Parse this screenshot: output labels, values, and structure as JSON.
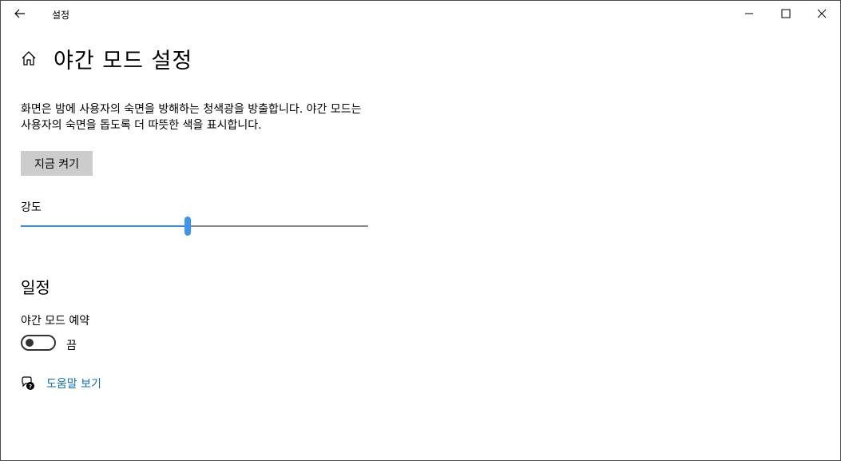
{
  "titlebar": {
    "app_title": "설정",
    "icons": [
      "back-arrow-icon",
      "minimize-icon",
      "maximize-icon",
      "close-icon"
    ]
  },
  "header": {
    "title": "야간 모드 설정",
    "icon": "home-icon"
  },
  "description": "화면은 밤에 사용자의 숙면을 방해하는 청색광을 방출합니다. 야간 모드는 사용자의 숙면을 돕도록 더 따뜻한 색을 표시합니다.",
  "turn_on_now": {
    "label": "지금 켜기"
  },
  "strength": {
    "label": "강도",
    "value_fraction": 0.48,
    "accent_color": "#3a96f0"
  },
  "schedule": {
    "section_title": "일정",
    "toggle_label": "야간 모드 예약",
    "toggle_on": false,
    "toggle_state_text": "끔"
  },
  "help": {
    "icon": "help-chat-icon",
    "link_text": "도움말 보기",
    "link_color": "#0a6fc2"
  }
}
